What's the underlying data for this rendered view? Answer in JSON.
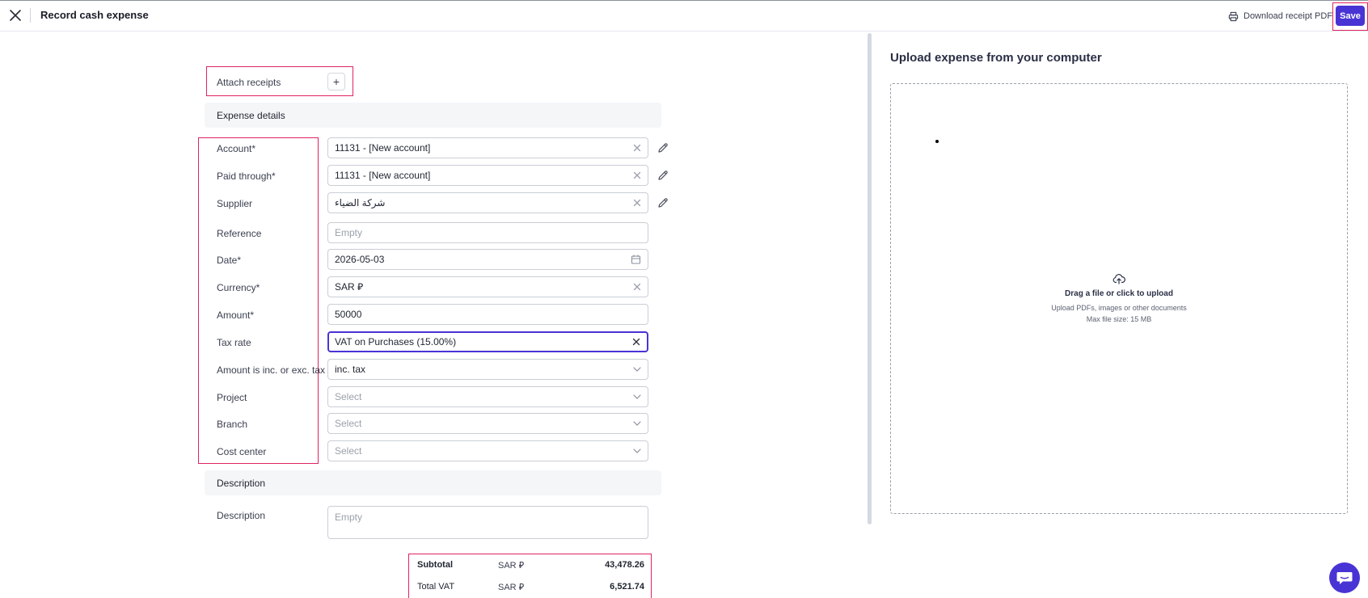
{
  "header": {
    "title": "Record cash expense",
    "download_label": "Download receipt PDF",
    "save_label": "Save"
  },
  "attach": {
    "label": "Attach receipts",
    "plus": "+"
  },
  "sections": {
    "expense_details": "Expense details",
    "description": "Description"
  },
  "fields": [
    {
      "label": "Account*",
      "value": "11131 - [New account]",
      "placeholder": "",
      "suffix": "clear",
      "pencil": true
    },
    {
      "label": "Paid through*",
      "value": "11131 - [New account]",
      "placeholder": "",
      "suffix": "clear",
      "pencil": true
    },
    {
      "label": "Supplier",
      "value": "شركة الضياء",
      "placeholder": "",
      "suffix": "clear",
      "pencil": true
    },
    {
      "label": "Reference",
      "value": "",
      "placeholder": "Empty",
      "suffix": "none",
      "pencil": false
    },
    {
      "label": "Date*",
      "value": "2026-05-03",
      "placeholder": "",
      "suffix": "calendar",
      "pencil": false
    },
    {
      "label": "Currency*",
      "value": "SAR ⃁",
      "placeholder": "",
      "suffix": "clear",
      "pencil": false
    },
    {
      "label": "Amount*",
      "value": "50000",
      "placeholder": "",
      "suffix": "none",
      "pencil": false
    },
    {
      "label": "Tax rate",
      "value": "VAT on Purchases (15.00%)",
      "placeholder": "",
      "suffix": "clear",
      "pencil": false,
      "focused": true
    },
    {
      "label": "Amount is inc. or exc. tax",
      "value": "inc. tax",
      "placeholder": "",
      "suffix": "chevron",
      "pencil": false
    },
    {
      "label": "Project",
      "value": "",
      "placeholder": "Select",
      "suffix": "chevron",
      "pencil": false
    },
    {
      "label": "Branch",
      "value": "",
      "placeholder": "Select",
      "suffix": "chevron",
      "pencil": false
    },
    {
      "label": "Cost center",
      "value": "",
      "placeholder": "Select",
      "suffix": "chevron",
      "pencil": false
    }
  ],
  "description": {
    "label": "Description",
    "placeholder": "Empty"
  },
  "totals": {
    "subtotal_label": "Subtotal",
    "subtotal_currency": "SAR ⃁",
    "subtotal_value": "43,478.26",
    "vat_label": "Total VAT",
    "vat_currency": "SAR ⃁",
    "vat_value": "6,521.74"
  },
  "upload": {
    "title": "Upload expense from your computer",
    "main": "Drag a file or click to upload",
    "sub1": "Upload PDFs, images or other documents",
    "sub2": "Max file size: 15 MB"
  },
  "colors": {
    "accent": "#4834d4",
    "highlight_border": "#e0245e",
    "section_bg": "#f5f6f8"
  }
}
